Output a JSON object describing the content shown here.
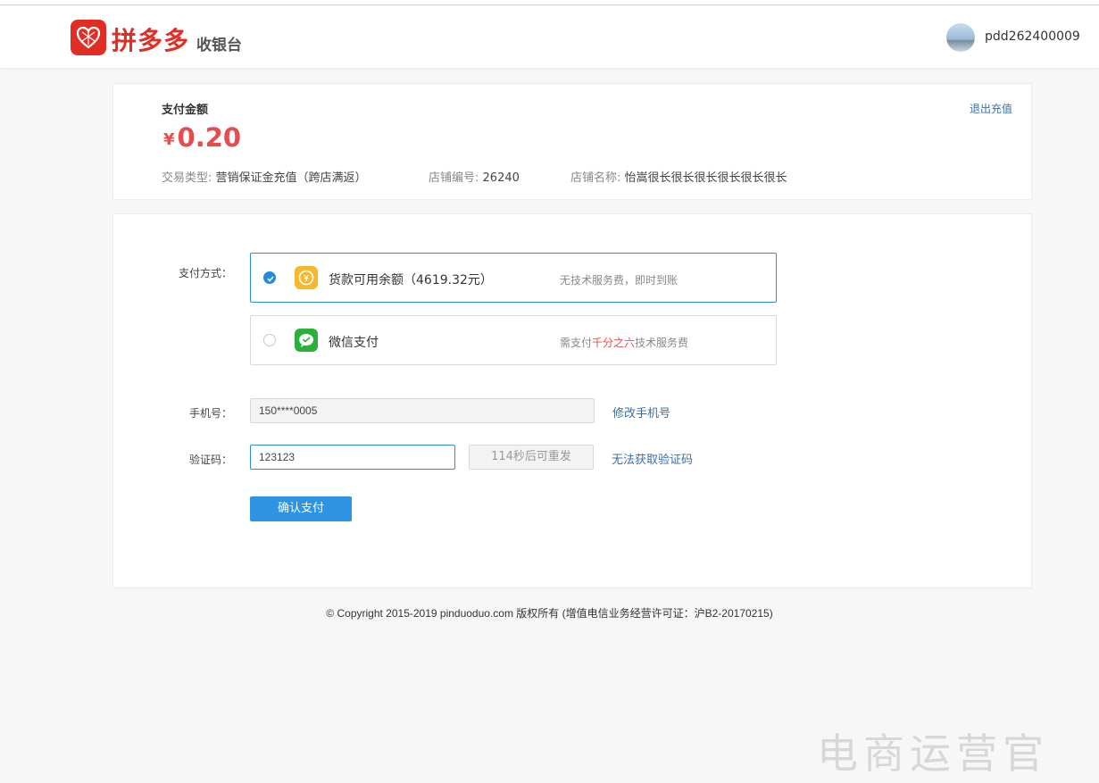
{
  "header": {
    "brand": "拼多多",
    "subtitle": "收银台",
    "username": "pdd262400009"
  },
  "summary": {
    "amount_label": "支付金额",
    "currency": "¥",
    "amount": "0.20",
    "exit_link": "退出充值",
    "trade_type_label": "交易类型:",
    "trade_type_value": "营销保证金充值（跨店满返）",
    "shop_id_label": "店铺编号:",
    "shop_id_value": "26240",
    "shop_name_label": "店铺名称:",
    "shop_name_value": "怡嵩很长很长很长很长很长很长"
  },
  "payment": {
    "method_label": "支付方式：",
    "options": [
      {
        "title": "货款可用余额（4619.32元）",
        "note": "无技术服务费，即时到账",
        "selected": true
      },
      {
        "title": "微信支付",
        "note_prefix": "需支付",
        "note_highlight": "千分之六",
        "note_suffix": "技术服务费",
        "selected": false
      }
    ],
    "phone_label": "手机号：",
    "phone_value": "150****0005",
    "change_phone": "修改手机号",
    "code_label": "验证码：",
    "code_value": "123123",
    "resend": "114秒后可重发",
    "cant_get_code": "无法获取验证码",
    "confirm": "确认支付"
  },
  "footer": {
    "copyright": "© Copyright 2015-2019 pinduoduo.com 版权所有 (增值电信业务经营许可证：沪B2-20170215)"
  },
  "watermark": "电商运营官",
  "colors": {
    "brand_red": "#e02e24",
    "amount_red": "#e64c4c",
    "primary_blue": "#2d93e2",
    "link_blue": "#3b6fa8",
    "wechat_green": "#2ab13a",
    "balance_yellow": "#f5b82e"
  }
}
